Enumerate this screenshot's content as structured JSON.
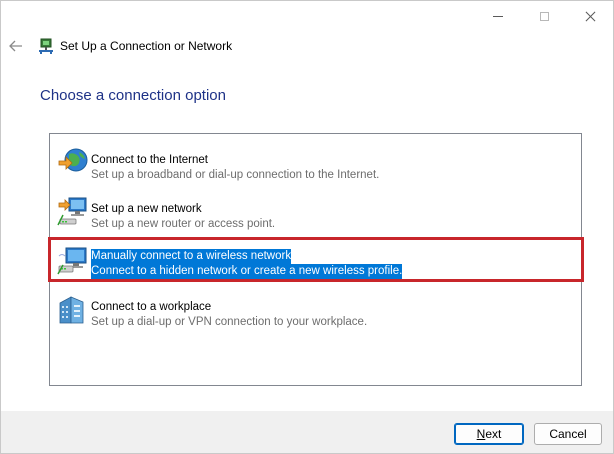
{
  "window": {
    "title": "Set Up a Connection or Network",
    "minimize_icon": "minimize-icon",
    "maximize_icon": "maximize-icon",
    "close_icon": "close-icon"
  },
  "header": {
    "back_icon": "arrow-left-icon",
    "wizard_icon": "network-setup-icon",
    "heading": "Choose a connection option"
  },
  "options": [
    {
      "title": "Connect to the Internet",
      "description": "Set up a broadband or dial-up connection to the Internet.",
      "icon": "globe-internet-icon",
      "selected": false
    },
    {
      "title": "Set up a new network",
      "description": "Set up a new router or access point.",
      "icon": "new-network-icon",
      "selected": false
    },
    {
      "title": "Manually connect to a wireless network",
      "description": "Connect to a hidden network or create a new wireless profile.",
      "icon": "wireless-network-icon",
      "selected": true
    },
    {
      "title": "Connect to a workplace",
      "description": "Set up a dial-up or VPN connection to your workplace.",
      "icon": "workplace-building-icon",
      "selected": false
    }
  ],
  "footer": {
    "next_label": "Next",
    "cancel_label": "Cancel"
  },
  "colors": {
    "heading": "#1e3287",
    "selection": "#0078d7",
    "annotation_highlight": "#c8262b",
    "footer_background": "#f0f0f0"
  }
}
